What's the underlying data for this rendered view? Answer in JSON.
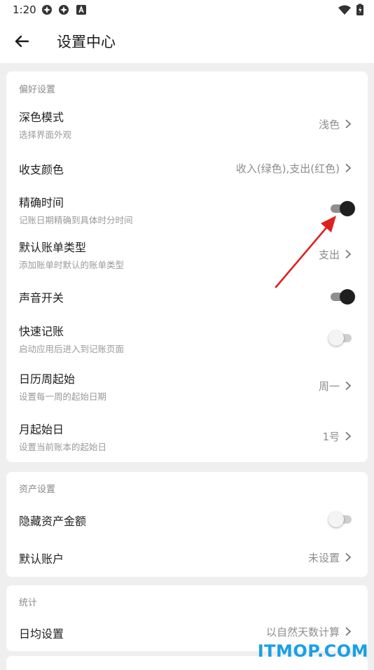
{
  "status": {
    "time": "1:20"
  },
  "header": {
    "title": "设置中心"
  },
  "preferences": {
    "section_title": "偏好设置",
    "dark_mode": {
      "title": "深色模式",
      "subtitle": "选择界面外观",
      "value": "浅色"
    },
    "income_color": {
      "title": "收支颜色",
      "value": "收入(绿色),支出(红色)"
    },
    "precise_time": {
      "title": "精确时间",
      "subtitle": "记账日期精确到具体时分时间",
      "enabled": true
    },
    "default_bill_type": {
      "title": "默认账单类型",
      "subtitle": "添加账单时默认的账单类型",
      "value": "支出"
    },
    "sound": {
      "title": "声音开关",
      "enabled": true
    },
    "quick_record": {
      "title": "快速记账",
      "subtitle": "启动应用后进入到记账页面",
      "enabled": false
    },
    "week_start": {
      "title": "日历周起始",
      "subtitle": "设置每一周的起始日期",
      "value": "周一"
    },
    "month_start": {
      "title": "月起始日",
      "subtitle": "设置当前账本的起始日",
      "value": "1号"
    }
  },
  "assets": {
    "section_title": "资产设置",
    "hide_amount": {
      "title": "隐藏资产金额",
      "enabled": false
    },
    "default_account": {
      "title": "默认账户",
      "value": "未设置"
    }
  },
  "stats": {
    "section_title": "统计",
    "daily_avg": {
      "title": "日均设置",
      "value": "以自然天数计算"
    }
  },
  "watermark": "ITMOP.COM",
  "colors": {
    "accent_arrow": "#e02020",
    "watermark": "#1aa0e6",
    "toggle_on_knob": "#1f1f1f"
  }
}
